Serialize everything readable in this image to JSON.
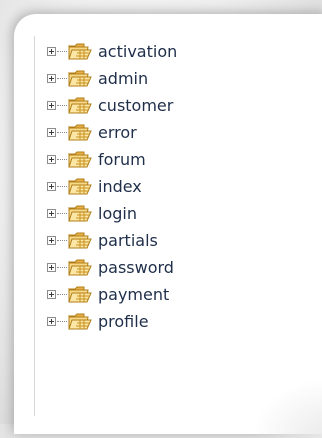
{
  "tree": {
    "items": [
      {
        "label": "activation"
      },
      {
        "label": "admin"
      },
      {
        "label": "customer"
      },
      {
        "label": "error"
      },
      {
        "label": "forum"
      },
      {
        "label": "index"
      },
      {
        "label": "login"
      },
      {
        "label": "partials"
      },
      {
        "label": "password"
      },
      {
        "label": "payment"
      },
      {
        "label": "profile"
      }
    ]
  },
  "colors": {
    "folder_fill": "#f7d98a",
    "folder_stroke": "#b07d15",
    "label_text": "#1f2f4a"
  },
  "icons": {
    "expander": "plus-box",
    "node": "open-folder"
  }
}
